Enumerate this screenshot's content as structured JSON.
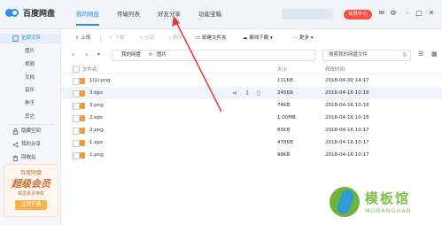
{
  "app": {
    "name": "百度网盘"
  },
  "nav": {
    "tabs": [
      "我的网盘",
      "传输列表",
      "好友分享",
      "功能宝箱"
    ],
    "active": 0
  },
  "header": {
    "vip_label": "会员中心"
  },
  "sidebar": {
    "items": [
      "全部文件",
      "图片",
      "视频",
      "文档",
      "音乐",
      "种子",
      "其它"
    ],
    "extra": [
      "隐藏空间",
      "我的分享",
      "回收站"
    ],
    "promo": {
      "line1": "百度网盘",
      "line2": "超级会员",
      "line3": "尊享更多特权",
      "button": "立即开通"
    }
  },
  "toolbar": {
    "upload": "上传",
    "download": "下载",
    "share": "分享",
    "delete": "删除",
    "new_folder": "新建文件夹",
    "offline": "离线下载",
    "more": "更多"
  },
  "path": {
    "crumbs": [
      "我的网盘",
      "图片"
    ],
    "search_placeholder": "搜索我的网盘文件"
  },
  "table": {
    "headers": {
      "name": "文件名",
      "size": "大小",
      "date": "修改时间"
    },
    "rows": [
      {
        "name": "1(1).png",
        "size": "111KB",
        "date": "2018-04-30 14:17"
      },
      {
        "name": "3.eps",
        "size": "245KB",
        "date": "2018-04-16 10:18"
      },
      {
        "name": "3.png",
        "size": "74KB",
        "date": "2018-04-16 10:18"
      },
      {
        "name": "2.eps",
        "size": "1.00MB",
        "date": "2018-04-16 10:18"
      },
      {
        "name": "2.png",
        "size": "85KB",
        "date": "2018-04-16 10:17"
      },
      {
        "name": "1.eps",
        "size": "478KB",
        "date": "2018-04-16 10:17"
      },
      {
        "name": "1.png",
        "size": "98KB",
        "date": "2018-04-16 10:17"
      }
    ]
  },
  "watermark": {
    "title": "模板馆",
    "sub": "MOBANGUAN"
  },
  "colors": {
    "accent": "#2f8bf3",
    "vip": "#ff4e3f",
    "annotation_arrow": "#e53935"
  }
}
